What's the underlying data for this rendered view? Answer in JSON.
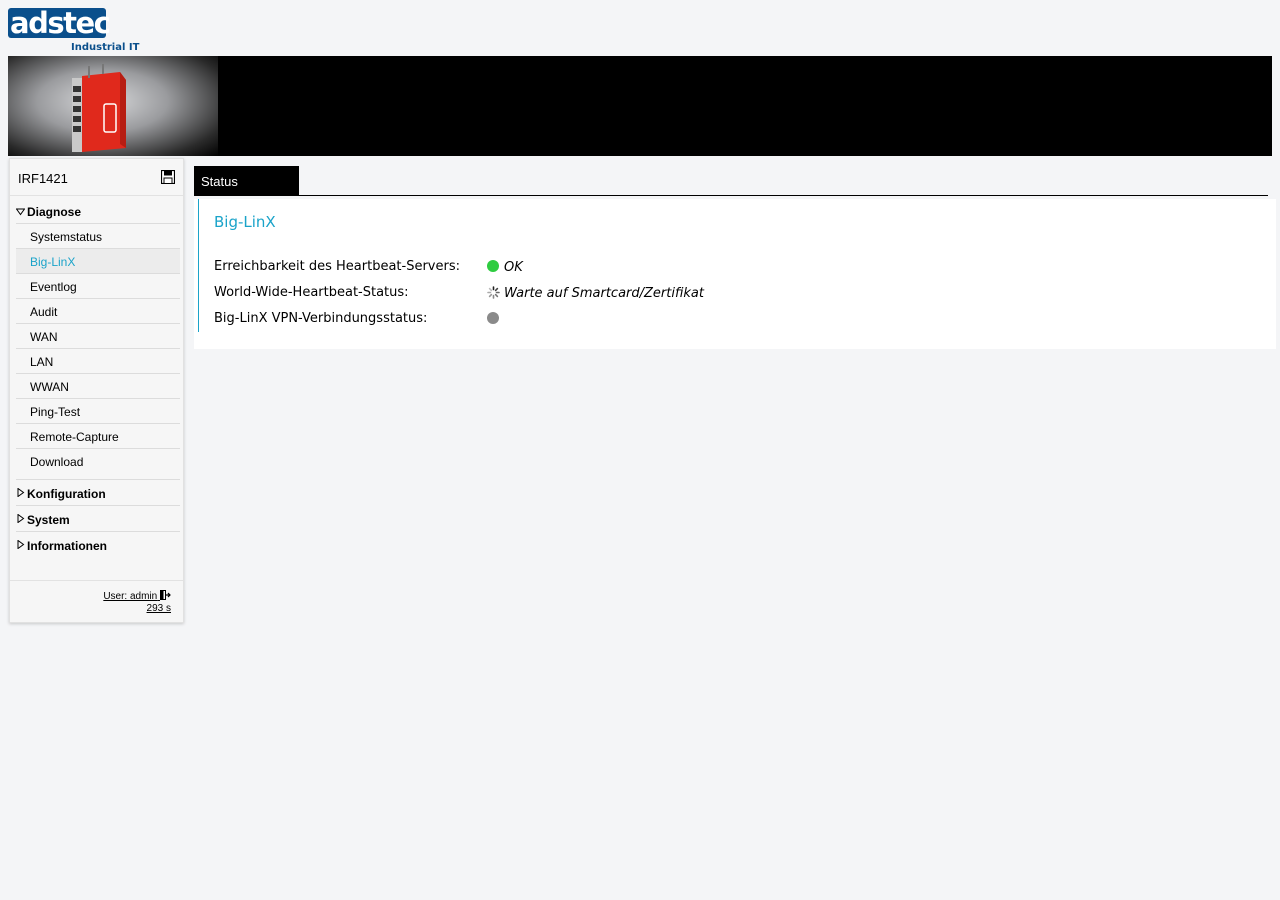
{
  "brand": {
    "logo_text": "adstec",
    "tagline": "Industrial IT"
  },
  "device": {
    "name": "IRF1421"
  },
  "nav": {
    "groups": [
      {
        "label": "Diagnose",
        "expanded": true,
        "items": [
          {
            "label": "Systemstatus"
          },
          {
            "label": "Big-LinX",
            "active": true
          },
          {
            "label": "Eventlog"
          },
          {
            "label": "Audit"
          },
          {
            "label": "WAN"
          },
          {
            "label": "LAN"
          },
          {
            "label": "WWAN"
          },
          {
            "label": "Ping-Test"
          },
          {
            "label": "Remote-Capture"
          },
          {
            "label": "Download"
          }
        ]
      },
      {
        "label": "Konfiguration",
        "expanded": false
      },
      {
        "label": "System",
        "expanded": false
      },
      {
        "label": "Informationen",
        "expanded": false
      }
    ]
  },
  "session": {
    "user_label": "User: admin",
    "timer": "293 s"
  },
  "tabs": [
    {
      "label": "Status",
      "active": true
    }
  ],
  "panel": {
    "title": "Big-LinX",
    "rows": [
      {
        "label": "Erreichbarkeit des Heartbeat-Servers:",
        "value": "OK",
        "indicator": "green-dot-icon"
      },
      {
        "label": "World-Wide-Heartbeat-Status:",
        "value": "Warte auf Smartcard/Zertifikat",
        "indicator": "spinner-icon"
      },
      {
        "label": "Big-LinX VPN-Verbindungsstatus:",
        "value": "",
        "indicator": "grey-dot-icon"
      }
    ]
  },
  "colors": {
    "brand_blue": "#0a4f8c",
    "accent": "#1aa3c9",
    "status_ok": "#2ecc40",
    "status_off": "#8a8a8a"
  }
}
